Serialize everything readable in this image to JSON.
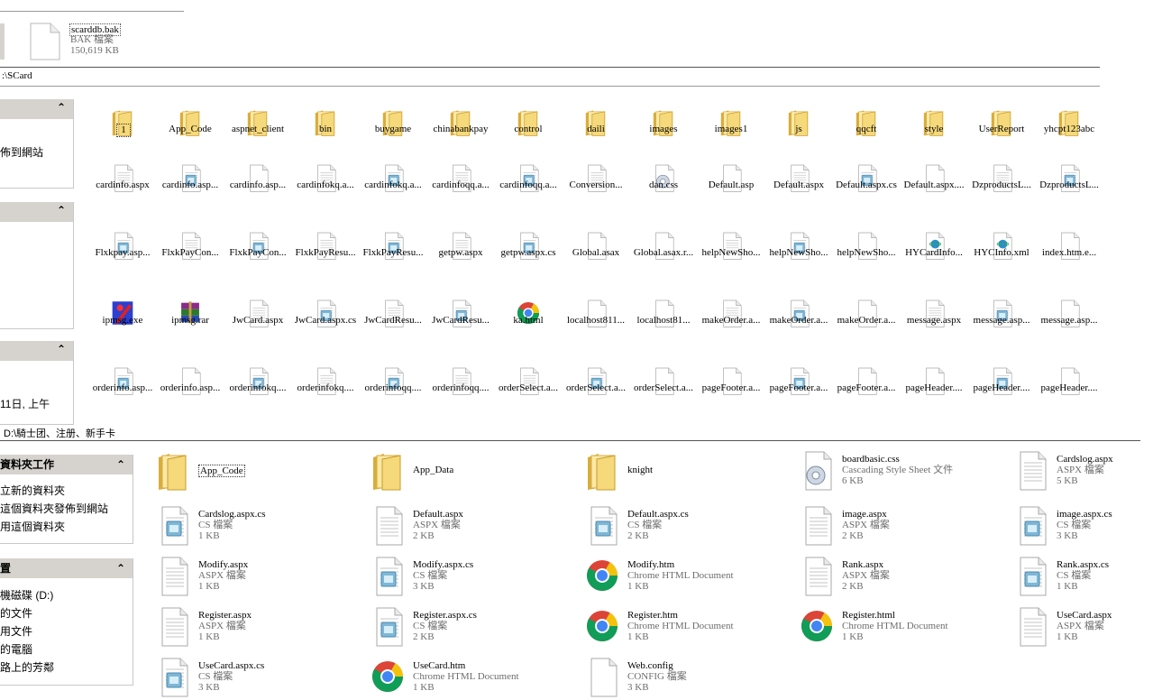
{
  "top_file": {
    "name": "scarddb.bak",
    "type": "BAK 檔案",
    "size": "150,619 KB"
  },
  "upper": {
    "address": ":\\SCard",
    "panes": [
      {
        "item": "佈到網站"
      },
      {
        "item": ""
      },
      {
        "item": "11日, 上午"
      }
    ],
    "rows": [
      {
        "kind": "folder",
        "items": [
          "1",
          "App_Code",
          "aspnet_client",
          "bin",
          "buygame",
          "chinabankpay",
          "control",
          "daili",
          "images",
          "images1",
          "js",
          "qqcft",
          "style",
          "UserReport",
          "yhcpt123abc"
        ]
      },
      {
        "kind": "file",
        "items": [
          "cardinfo.aspx",
          "cardinfo.asp...",
          "cardinfo.asp...",
          "cardinfokq.a...",
          "cardinfokq.a...",
          "cardinfoqq.a...",
          "cardinfoqq.a...",
          "Conversion...",
          "dan.css",
          "Default.asp",
          "Default.aspx",
          "Default.aspx.cs",
          "Default.aspx....",
          "DzproductsL...",
          "DzproductsL..."
        ],
        "icons": [
          "aspx",
          "cs",
          "blank",
          "aspx",
          "cs",
          "aspx",
          "cs",
          "aspx",
          "css",
          "blank",
          "aspx",
          "cs",
          "blank",
          "aspx",
          "cs"
        ]
      },
      {
        "kind": "file",
        "items": [
          "Flxkpay.asp...",
          "FlxkPayCon...",
          "FlxkPayCon...",
          "FlxkPayResu...",
          "FlxkPayResu...",
          "getpw.aspx",
          "getpw.aspx.cs",
          "Global.asax",
          "Global.asax.r...",
          "helpNewSho...",
          "helpNewSho...",
          "helpNewSho...",
          "HYCardInfo...",
          "HYCInfo.xml",
          "index.htm.e..."
        ],
        "icons": [
          "cs",
          "aspx",
          "cs",
          "aspx",
          "cs",
          "aspx",
          "cs",
          "blank",
          "blank",
          "aspx",
          "cs",
          "blank",
          "xml",
          "xml",
          "blank"
        ]
      },
      {
        "kind": "file",
        "items": [
          "ipmsg.exe",
          "ipmsg.rar",
          "JwCard.aspx",
          "JwCard.aspx.cs",
          "JwCardResu...",
          "JwCardResu...",
          "ka.html",
          "localhost811...",
          "localhost81...",
          "makeOrder.a...",
          "makeOrder.a...",
          "makeOrder.a...",
          "message.aspx",
          "message.asp...",
          "message.asp..."
        ],
        "icons": [
          "exe",
          "rar",
          "aspx",
          "cs",
          "aspx",
          "cs",
          "chrome",
          "blank",
          "blank",
          "aspx",
          "cs",
          "blank",
          "aspx",
          "cs",
          "blank"
        ]
      },
      {
        "kind": "file",
        "items": [
          "orderinfo.asp...",
          "orderinfo.asp...",
          "orderinfokq....",
          "orderinfokq....",
          "orderinfoqq....",
          "orderinfoqq....",
          "orderSelect.a...",
          "orderSelect.a...",
          "orderSelect.a...",
          "pageFooter.a...",
          "pageFooter.a...",
          "pageFooter.a...",
          "pageHeader....",
          "pageHeader....",
          "pageHeader...."
        ],
        "icons": [
          "cs",
          "blank",
          "cs",
          "aspx",
          "cs",
          "aspx",
          "aspx",
          "cs",
          "blank",
          "blank",
          "cs",
          "blank",
          "blank",
          "cs",
          "blank"
        ]
      }
    ]
  },
  "lower": {
    "address": "D:\\騎士团、注册、新手卡",
    "pane1": {
      "title": "資料夾工作",
      "items": [
        "立新的資料夾",
        "這個資料夾發佈到網站",
        "用這個資料夾"
      ]
    },
    "pane2": {
      "title": "置",
      "items": [
        "機磁碟 (D:)",
        "的文件",
        "用文件",
        "的電腦",
        "路上的芳鄰"
      ]
    },
    "tiles": [
      {
        "name": "App_Code",
        "type": "",
        "size": "",
        "icon": "folder"
      },
      {
        "name": "App_Data",
        "type": "",
        "size": "",
        "icon": "folder"
      },
      {
        "name": "knight",
        "type": "",
        "size": "",
        "icon": "folder"
      },
      {
        "name": "boardbasic.css",
        "type": "Cascading Style Sheet 文件",
        "size": "6 KB",
        "icon": "css"
      },
      {
        "name": "Cardslog.aspx",
        "type": "ASPX 檔案",
        "size": "5 KB",
        "icon": "aspx"
      },
      {
        "name": "Cardslog.aspx.cs",
        "type": "CS 檔案",
        "size": "1 KB",
        "icon": "cs"
      },
      {
        "name": "Default.aspx",
        "type": "ASPX 檔案",
        "size": "2 KB",
        "icon": "aspx"
      },
      {
        "name": "Default.aspx.cs",
        "type": "CS 檔案",
        "size": "2 KB",
        "icon": "cs"
      },
      {
        "name": "image.aspx",
        "type": "ASPX 檔案",
        "size": "2 KB",
        "icon": "aspx"
      },
      {
        "name": "image.aspx.cs",
        "type": "CS 檔案",
        "size": "3 KB",
        "icon": "cs"
      },
      {
        "name": "Modify.aspx",
        "type": "ASPX 檔案",
        "size": "1 KB",
        "icon": "aspx"
      },
      {
        "name": "Modify.aspx.cs",
        "type": "CS 檔案",
        "size": "3 KB",
        "icon": "cs"
      },
      {
        "name": "Modify.htm",
        "type": "Chrome HTML Document",
        "size": "1 KB",
        "icon": "chrome"
      },
      {
        "name": "Rank.aspx",
        "type": "ASPX 檔案",
        "size": "2 KB",
        "icon": "aspx"
      },
      {
        "name": "Rank.aspx.cs",
        "type": "CS 檔案",
        "size": "1 KB",
        "icon": "cs"
      },
      {
        "name": "Register.aspx",
        "type": "ASPX 檔案",
        "size": "1 KB",
        "icon": "aspx"
      },
      {
        "name": "Register.aspx.cs",
        "type": "CS 檔案",
        "size": "2 KB",
        "icon": "cs"
      },
      {
        "name": "Register.htm",
        "type": "Chrome HTML Document",
        "size": "1 KB",
        "icon": "chrome"
      },
      {
        "name": "Register.html",
        "type": "Chrome HTML Document",
        "size": "1 KB",
        "icon": "chrome"
      },
      {
        "name": "UseCard.aspx",
        "type": "ASPX 檔案",
        "size": "1 KB",
        "icon": "aspx"
      },
      {
        "name": "UseCard.aspx.cs",
        "type": "CS 檔案",
        "size": "3 KB",
        "icon": "cs"
      },
      {
        "name": "UseCard.htm",
        "type": "Chrome HTML Document",
        "size": "1 KB",
        "icon": "chrome"
      },
      {
        "name": "Web.config",
        "type": "CONFIG 檔案",
        "size": "3 KB",
        "icon": "blank"
      }
    ]
  },
  "colors": {
    "pane_header": "#d6d3ce",
    "folder": "#f5d97a",
    "folder_dark": "#d9ad3c",
    "cs_tint": "#7fb7d6"
  }
}
